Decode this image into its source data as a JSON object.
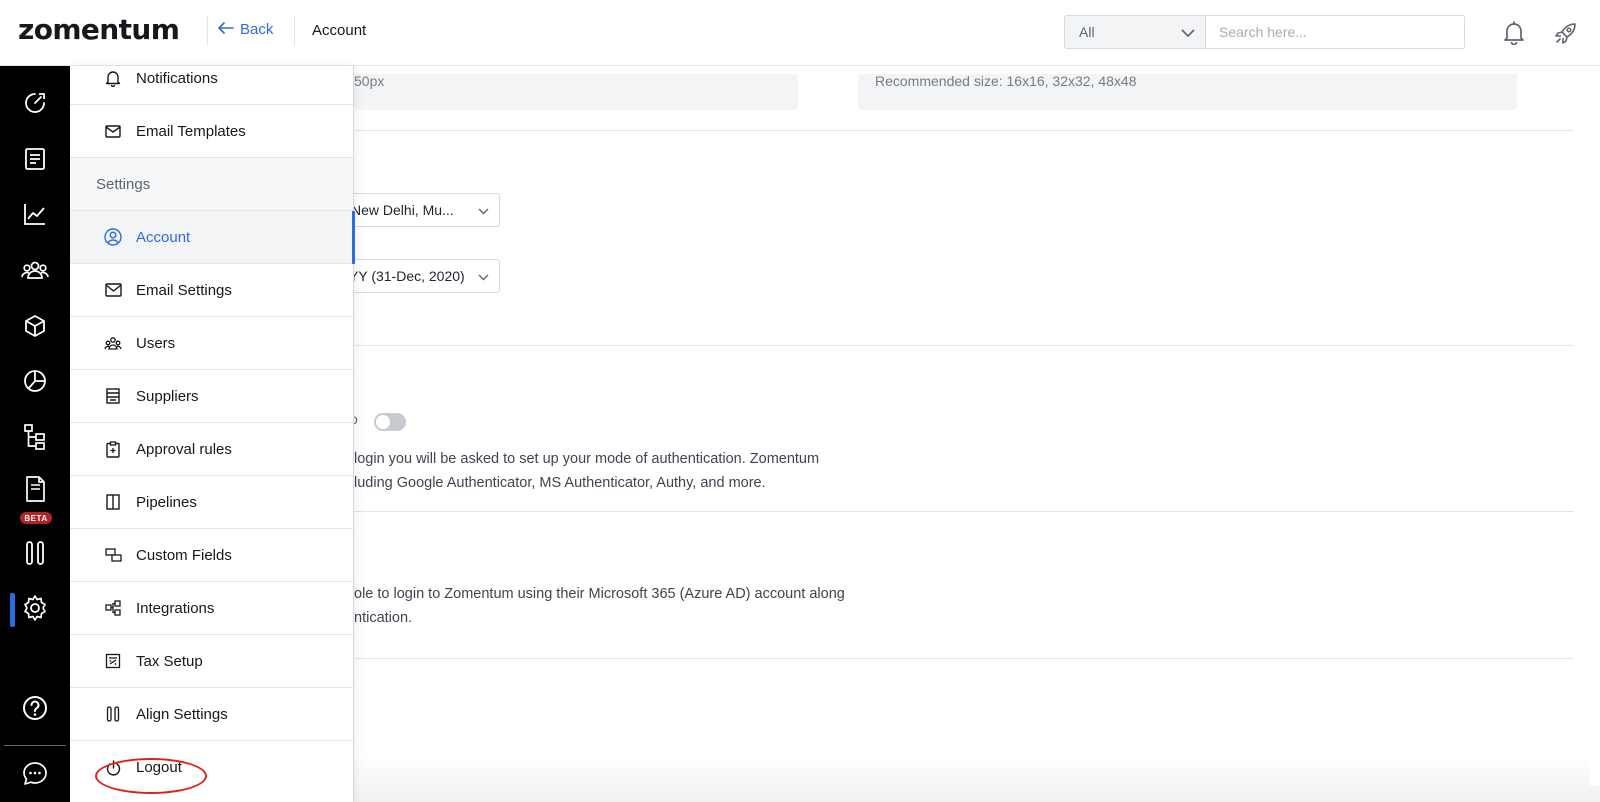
{
  "header": {
    "logo": "zomentum",
    "back_label": "Back",
    "breadcrumb": "Account",
    "search": {
      "scope_value": "All",
      "placeholder": "Search here..."
    }
  },
  "rail": {
    "items": [
      {
        "icon": "dashboard-icon"
      },
      {
        "icon": "document-icon"
      },
      {
        "icon": "analytics-icon"
      },
      {
        "icon": "clients-icon"
      },
      {
        "icon": "products-icon"
      },
      {
        "icon": "reports-icon"
      },
      {
        "icon": "hierarchy-icon"
      },
      {
        "icon": "purchase-order-icon",
        "badge": "BETA"
      },
      {
        "icon": "align-icon"
      },
      {
        "icon": "settings-icon",
        "active": true
      }
    ],
    "help_icon": "help-icon",
    "chat_icon": "chat-icon"
  },
  "menu": {
    "items_top": [
      {
        "label": "Notifications",
        "icon": "bell-icon"
      },
      {
        "label": "Email Templates",
        "icon": "mail-icon"
      }
    ],
    "section_label": "Settings",
    "items": [
      {
        "label": "Account",
        "icon": "user-circle-icon",
        "active": true
      },
      {
        "label": "Email Settings",
        "icon": "envelope-icon"
      },
      {
        "label": "Users",
        "icon": "users-icon"
      },
      {
        "label": "Suppliers",
        "icon": "store-icon"
      },
      {
        "label": "Approval rules",
        "icon": "clipboard-icon"
      },
      {
        "label": "Pipelines",
        "icon": "columns-icon"
      },
      {
        "label": "Custom Fields",
        "icon": "fields-icon"
      },
      {
        "label": "Integrations",
        "icon": "integrations-icon"
      },
      {
        "label": "Tax Setup",
        "icon": "tax-icon"
      },
      {
        "label": "Align Settings",
        "icon": "align-settings-icon"
      }
    ],
    "logout_label": "Logout"
  },
  "content": {
    "logo_hint_partial": "50px",
    "favicon_hint": "Recommended size: 16x16, 32x32, 48x48",
    "timezone_value": "New Delhi, Mu...",
    "date_format_value": "YY (31-Dec, 2020)",
    "mfa_toggle_prefix": "o",
    "mfa_desc_line1": "login you will be asked to set up your mode of authentication. Zomentum",
    "mfa_desc_line2": "luding Google Authenticator, MS Authenticator, Authy, and more.",
    "azure_desc_line1": "ole to login to Zomentum using their Microsoft 365 (Azure AD) account along",
    "azure_desc_line2": "ntication."
  },
  "colors": {
    "accent": "#2c6be0",
    "rail_bg": "#000000",
    "badge": "#b3232a"
  }
}
